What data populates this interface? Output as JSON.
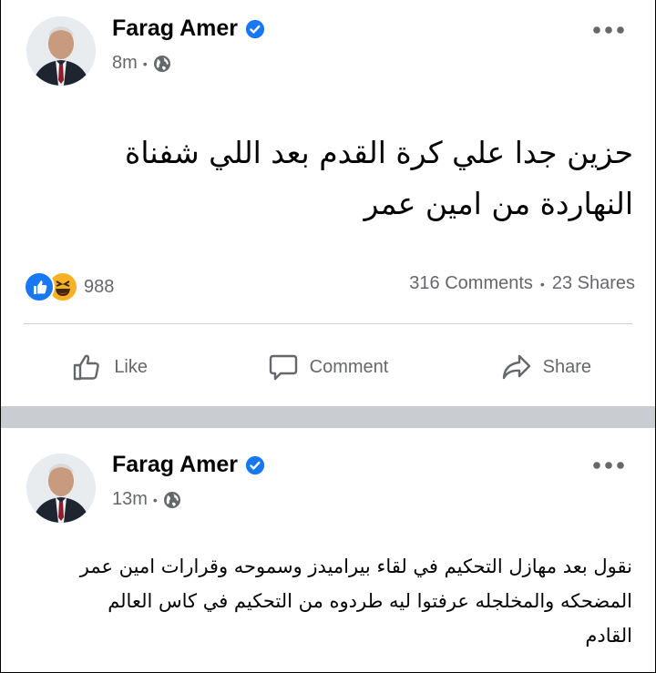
{
  "posts": [
    {
      "author": "Farag Amer",
      "verified": true,
      "time": "8m",
      "privacy_icon": "globe-icon",
      "text_lines": [
        "حزين جدا علي كرة  القدم بعد  اللي شفناة",
        "النهاردة من امين عمر"
      ],
      "reactions": {
        "icons": [
          "like-icon",
          "haha-icon"
        ],
        "count": "988"
      },
      "comments": "316 Comments",
      "shares": "23 Shares",
      "actions": {
        "like": "Like",
        "comment": "Comment",
        "share": "Share"
      }
    },
    {
      "author": "Farag Amer",
      "verified": true,
      "time": "13m",
      "privacy_icon": "globe-icon",
      "text_lines": [
        "نقول بعد مهازل التحكيم في لقاء بيراميدز وسموحه وقرارات امين عمر",
        "المضحكه والمخلجله عرفتوا ليه طردوه من التحكيم في كاس العالم",
        "القادم"
      ]
    }
  ],
  "colors": {
    "brand_blue": "#1877f2",
    "meta_gray": "#65676b",
    "separator": "#c9ccd1",
    "haha_yellow": "#f7b125"
  }
}
